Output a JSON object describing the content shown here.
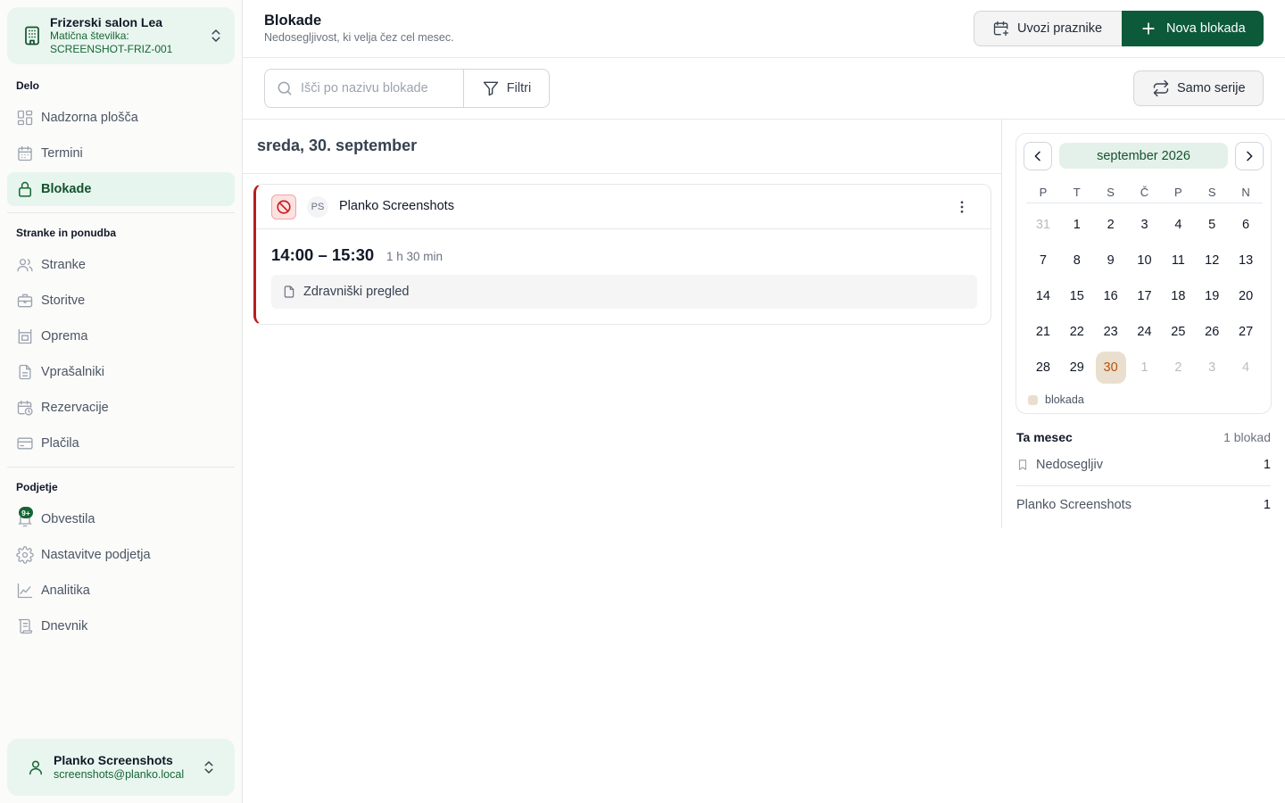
{
  "org": {
    "name": "Frizerski salon Lea",
    "reg_label": "Matična številka:",
    "reg_value": "SCREENSHOT-FRIZ-001"
  },
  "sidebar": {
    "sections": [
      {
        "title": "Delo",
        "items": [
          {
            "label": "Nadzorna plošča",
            "icon": "dashboard-icon"
          },
          {
            "label": "Termini",
            "icon": "calendar-icon"
          },
          {
            "label": "Blokade",
            "icon": "lock-icon",
            "active": true
          }
        ]
      },
      {
        "title": "Stranke in ponudba",
        "items": [
          {
            "label": "Stranke",
            "icon": "users-icon"
          },
          {
            "label": "Storitve",
            "icon": "briefcase-icon"
          },
          {
            "label": "Oprema",
            "icon": "equipment-icon"
          },
          {
            "label": "Vprašalniki",
            "icon": "document-icon"
          },
          {
            "label": "Rezervacije",
            "icon": "calendar-clock-icon"
          },
          {
            "label": "Plačila",
            "icon": "credit-card-icon"
          }
        ]
      },
      {
        "title": "Podjetje",
        "items": [
          {
            "label": "Obvestila",
            "icon": "bell-icon",
            "badge": "9+"
          },
          {
            "label": "Nastavitve podjetja",
            "icon": "gear-icon"
          },
          {
            "label": "Analitika",
            "icon": "chart-line-icon"
          },
          {
            "label": "Dnevnik",
            "icon": "scroll-icon"
          }
        ]
      }
    ]
  },
  "user": {
    "name": "Planko Screenshots",
    "email": "screenshots@planko.local"
  },
  "header": {
    "title": "Blokade",
    "subtitle": "Nedosegljivost, ki velja čez cel mesec.",
    "import_label": "Uvozi praznike",
    "new_label": "Nova blokada"
  },
  "toolbar": {
    "search_placeholder": "Išči po nazivu blokade",
    "filter_label": "Filtri",
    "series_label": "Samo serije"
  },
  "day": {
    "title": "sreda, 30. september",
    "blocks": [
      {
        "owner_initials": "PS",
        "owner_name": "Planko Screenshots",
        "time": "14:00 – 15:30",
        "duration": "1 h 30 min",
        "note": "Zdravniški pregled",
        "status_color": "#b91c1c"
      }
    ]
  },
  "calendar": {
    "month_label": "september 2026",
    "weekdays": [
      "P",
      "T",
      "S",
      "Č",
      "P",
      "S",
      "N"
    ],
    "days": [
      {
        "d": "31",
        "muted": true
      },
      {
        "d": "1"
      },
      {
        "d": "2"
      },
      {
        "d": "3"
      },
      {
        "d": "4"
      },
      {
        "d": "5"
      },
      {
        "d": "6"
      },
      {
        "d": "7"
      },
      {
        "d": "8"
      },
      {
        "d": "9"
      },
      {
        "d": "10"
      },
      {
        "d": "11"
      },
      {
        "d": "12"
      },
      {
        "d": "13"
      },
      {
        "d": "14"
      },
      {
        "d": "15"
      },
      {
        "d": "16"
      },
      {
        "d": "17"
      },
      {
        "d": "18"
      },
      {
        "d": "19"
      },
      {
        "d": "20"
      },
      {
        "d": "21"
      },
      {
        "d": "22"
      },
      {
        "d": "23"
      },
      {
        "d": "24"
      },
      {
        "d": "25"
      },
      {
        "d": "26"
      },
      {
        "d": "27"
      },
      {
        "d": "28"
      },
      {
        "d": "29"
      },
      {
        "d": "30",
        "selected": true
      },
      {
        "d": "1",
        "muted": true
      },
      {
        "d": "2",
        "muted": true
      },
      {
        "d": "3",
        "muted": true
      },
      {
        "d": "4",
        "muted": true
      }
    ],
    "legend_label": "blokada",
    "legend_color": "#eadfce"
  },
  "summary": {
    "title": "Ta mesec",
    "count": "1 blokad",
    "rows": [
      {
        "label": "Nedosegljiv",
        "value": "1"
      },
      {
        "label": "Planko Screenshots",
        "value": "1"
      }
    ]
  },
  "colors": {
    "accent": "#0c5a3a",
    "active_bg": "#e6f5ed",
    "block_red": "#b91c1c"
  }
}
